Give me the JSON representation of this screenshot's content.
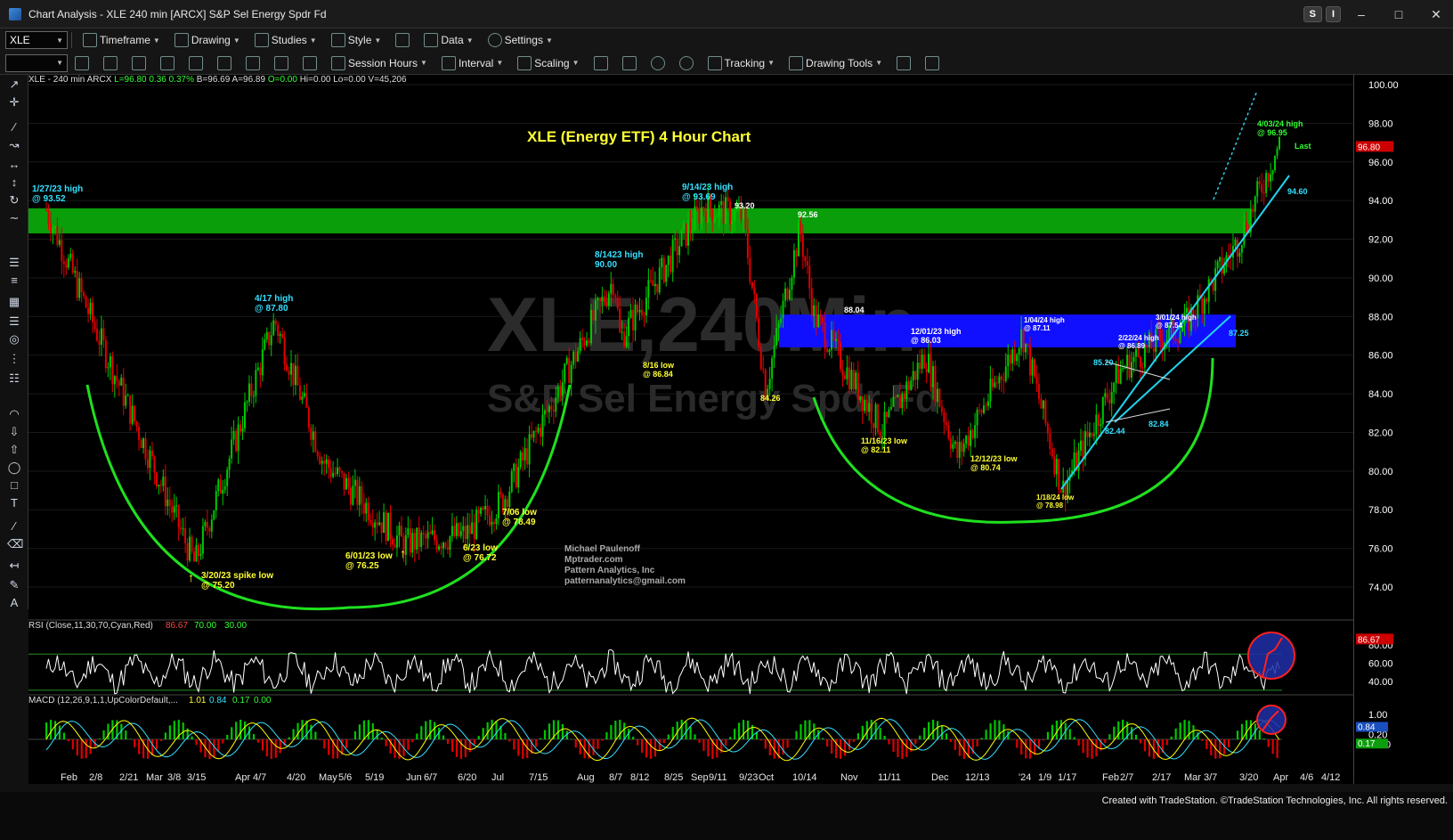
{
  "window": {
    "title": "Chart Analysis - XLE 240 min [ARCX] S&P Sel Energy Spdr Fd",
    "btn_s": "S",
    "btn_i": "I"
  },
  "toolbar1": {
    "symbol": "XLE",
    "items": [
      "Timeframe",
      "Drawing",
      "Studies",
      "Style",
      "Data",
      "Settings"
    ]
  },
  "toolbar2": {
    "items": [
      "Session Hours",
      "Interval",
      "Scaling",
      "Tracking",
      "Drawing Tools"
    ]
  },
  "status_line": {
    "sym": "XLE - 240 min  ARCX",
    "last": "L=96.80",
    "chg": "0.36",
    "pct": "0.37%",
    "rest": "B=96.69  A=96.89",
    "open": "O=0.00",
    "hilo": "Hi=0.00  Lo=0.00  V=45,206"
  },
  "chart_title": "XLE (Energy ETF) 4 Hour Chart",
  "watermark": {
    "line1": "XLE,240Min",
    "line2": "S&P Sel Energy Spdr Fd"
  },
  "author": [
    "Michael Paulenoff",
    "Mptrader.com",
    "Pattern Analytics, Inc",
    "patternanalytics@gmail.com"
  ],
  "colors": {
    "bull": "#00c800",
    "bear": "#e00000",
    "green_zone": "#0a9e0a",
    "blue_zone": "#1010ff",
    "cup_arc": "#1fe01f",
    "trend": "#22d3ee",
    "rsi_line": "#ffffff",
    "macd": "#ffff00"
  },
  "annotations": {
    "a1": [
      "1/27/23 high",
      "@ 93.52"
    ],
    "a2": [
      "4/17 high",
      "@ 87.80"
    ],
    "a3": [
      "3/20/23 spike low",
      "@ 75.20"
    ],
    "a4": [
      "6/01/23 low",
      "@ 76.25"
    ],
    "a5": [
      "6/23 low",
      "@ 76.72"
    ],
    "a6": [
      "7/06 low",
      "@ 78.49"
    ],
    "a7": [
      "8/1423 high",
      "90.00"
    ],
    "a8": [
      "8/16 low",
      "@ 86.84"
    ],
    "a9": [
      "9/14/23 high",
      "@ 93.69"
    ],
    "a10": "93.20",
    "a11": "92.56",
    "a12": "84.26",
    "a13": "88.04",
    "a14": [
      "12/01/23 high",
      "@ 86.03"
    ],
    "a15": [
      "1/04/24 high",
      "@ 87.11"
    ],
    "a16": [
      "11/16/23 low",
      "@ 82.11"
    ],
    "a17": [
      "12/12/23 low",
      "@ 80.74"
    ],
    "a18": [
      "1/18/24 low",
      "@ 78.98"
    ],
    "a19": "85.20",
    "a20": [
      "2/22/24 high",
      "@ 86.89"
    ],
    "a21": [
      "3/01/24 high",
      "@ 87.54"
    ],
    "a22": "87.25",
    "a23": "82.44",
    "a24": "82.84",
    "a25": [
      "4/03/24 high",
      "@ 96.95"
    ],
    "a26": "Last",
    "a27": "94.60"
  },
  "price_axis": {
    "ticks": [
      "100.00",
      "98.00",
      "96.00",
      "94.00",
      "92.00",
      "90.00",
      "88.00",
      "86.00",
      "84.00",
      "82.00",
      "80.00",
      "78.00",
      "76.00",
      "74.00"
    ],
    "last_tag": "96.80"
  },
  "rsi": {
    "label": "RSI (Close,11,30,70,Cyan,Red)",
    "v1": "86.67",
    "v2": "70.00",
    "v3": "30.00",
    "ticks": [
      "80.00",
      "60.00",
      "40.00"
    ],
    "tag": "86.67"
  },
  "macd": {
    "label": "MACD (12,26,9,1,1,UpColorDefault,...",
    "v1": "1.01",
    "v2": "0.84",
    "v3": "0.17",
    "v4": "0.00",
    "ticks": [
      "1.00",
      "0.20",
      "-0.20"
    ],
    "tag1": "0.84",
    "tag2": "0.17"
  },
  "x_axis": [
    "Feb",
    "2/8",
    "2/21",
    "Mar",
    "3/8",
    "3/15",
    "Apr",
    "4/7",
    "4/20",
    "May",
    "5/6",
    "5/19",
    "Jun",
    "6/7",
    "6/20",
    "Jul",
    "7/15",
    "Aug",
    "8/7",
    "8/12",
    "8/25",
    "Sep",
    "9/11",
    "9/23",
    "Oct",
    "10/14",
    "Nov",
    "11/11",
    "Dec",
    "12/13",
    "'24",
    "1/9",
    "1/17",
    "Feb",
    "2/7",
    "2/17",
    "Mar",
    "3/7",
    "3/20",
    "Apr",
    "4/6",
    "4/12"
  ],
  "footer": "Created with TradeStation. ©TradeStation Technologies, Inc. All rights reserved.",
  "chart_data": {
    "type": "candlestick",
    "title": "XLE (Energy ETF) 4 Hour Chart",
    "ylim": [
      72.5,
      100.5
    ],
    "close_path_dates": [
      "2023-01-27",
      "2023-02-10",
      "2023-03-20",
      "2023-04-17",
      "2023-05-04",
      "2023-06-01",
      "2023-06-23",
      "2023-07-06",
      "2023-08-14",
      "2023-08-16",
      "2023-09-14",
      "2023-09-28",
      "2023-10-06",
      "2023-10-18",
      "2023-10-23",
      "2023-11-16",
      "2023-12-01",
      "2023-12-12",
      "2024-01-04",
      "2024-01-18",
      "2024-02-07",
      "2024-02-22",
      "2024-03-01",
      "2024-03-20",
      "2024-04-03"
    ],
    "close_path_values": [
      93.52,
      88.5,
      75.2,
      87.8,
      80.5,
      76.25,
      76.72,
      78.49,
      90.0,
      86.84,
      93.69,
      93.2,
      84.26,
      92.56,
      88.04,
      82.11,
      86.03,
      80.74,
      87.11,
      78.98,
      85.2,
      86.89,
      87.54,
      92.0,
      96.95
    ],
    "resistance_zone": [
      92.3,
      93.6
    ],
    "support_zone": [
      86.4,
      88.1
    ],
    "last": 96.8
  }
}
